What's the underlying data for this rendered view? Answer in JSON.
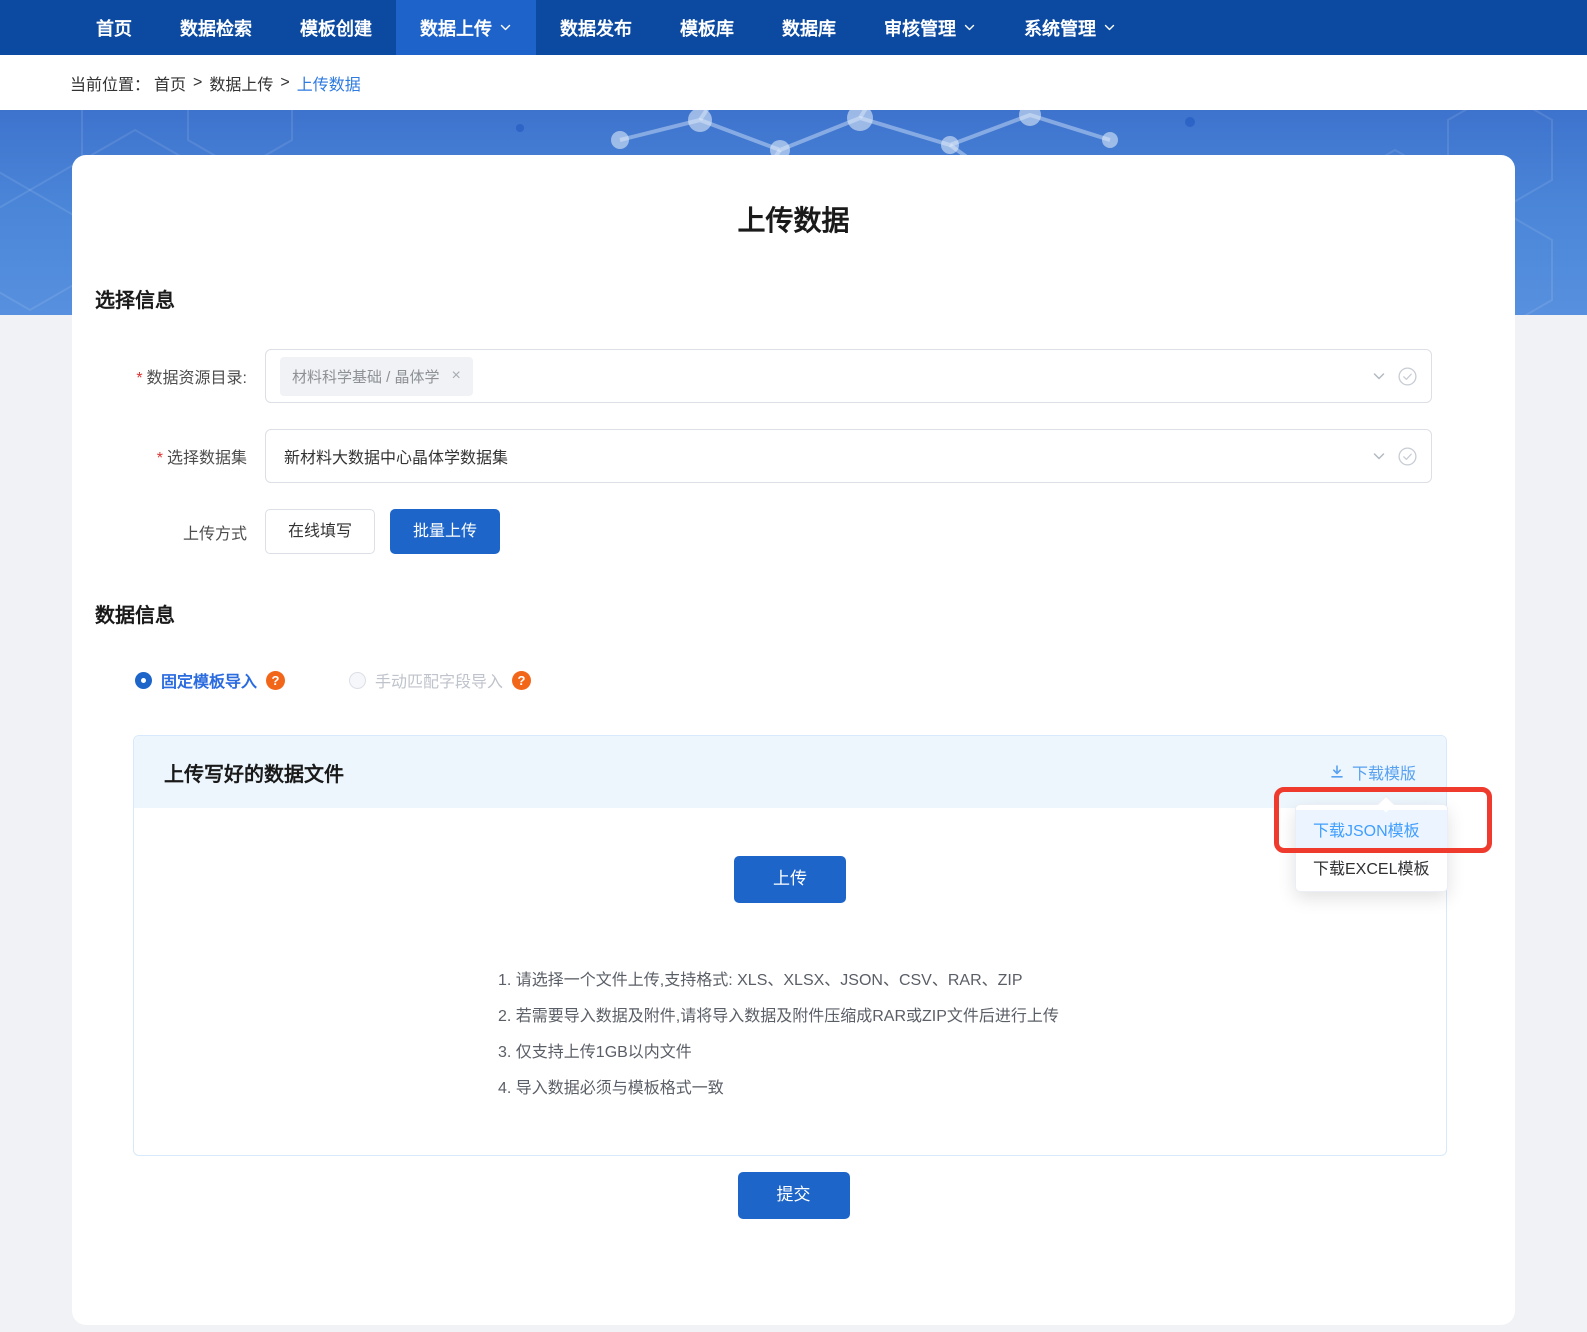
{
  "nav": {
    "items": [
      {
        "label": "首页",
        "active": false,
        "has_dropdown": false
      },
      {
        "label": "数据检索",
        "active": false,
        "has_dropdown": false
      },
      {
        "label": "模板创建",
        "active": false,
        "has_dropdown": false
      },
      {
        "label": "数据上传",
        "active": true,
        "has_dropdown": true
      },
      {
        "label": "数据发布",
        "active": false,
        "has_dropdown": false
      },
      {
        "label": "模板库",
        "active": false,
        "has_dropdown": false
      },
      {
        "label": "数据库",
        "active": false,
        "has_dropdown": false
      },
      {
        "label": "审核管理",
        "active": false,
        "has_dropdown": true
      },
      {
        "label": "系统管理",
        "active": false,
        "has_dropdown": true
      }
    ]
  },
  "breadcrumb": {
    "prefix": "当前位置：",
    "separator": ">",
    "items": [
      "首页",
      "数据上传",
      "上传数据"
    ]
  },
  "page": {
    "title": "上传数据"
  },
  "sections": {
    "select_info": "选择信息",
    "data_info": "数据信息"
  },
  "form": {
    "catalog": {
      "label": "数据资源目录:",
      "required": "*",
      "tag": "材料科学基础 / 晶体学",
      "tag_close": "×"
    },
    "dataset": {
      "label": "选择数据集",
      "required": "*",
      "value": "新材料大数据中心晶体学数据集"
    },
    "upload_method": {
      "label": "上传方式",
      "options": [
        {
          "label": "在线填写",
          "active": false
        },
        {
          "label": "批量上传",
          "active": true
        }
      ]
    }
  },
  "import_modes": {
    "fixed": {
      "label": "固定模板导入",
      "selected": true,
      "help": "?"
    },
    "manual": {
      "label": "手动匹配字段导入",
      "selected": false,
      "help": "?"
    }
  },
  "upload_panel": {
    "title": "上传写好的数据文件",
    "download_link": "下载模版",
    "upload_button": "上传",
    "instructions": [
      "1. 请选择一个文件上传,支持格式: XLS、XLSX、JSON、CSV、RAR、ZIP",
      "2. 若需要导入数据及附件,请将导入数据及附件压缩成RAR或ZIP文件后进行上传",
      "3. 仅支持上传1GB以内文件",
      "4. 导入数据必须与模板格式一致"
    ],
    "submit_button": "提交"
  },
  "download_menu": {
    "items": [
      {
        "label": "下载JSON模板",
        "highlighted": true
      },
      {
        "label": "下载EXCEL模板",
        "highlighted": false
      }
    ]
  },
  "colors": {
    "nav_bg": "#0c4aa1",
    "nav_active_bg": "#1e63c9",
    "primary_blue": "#1d65c9",
    "link_blue": "#2d7ae0",
    "light_link_blue": "#58a1f0",
    "menu_highlight_blue": "#409eff",
    "help_orange": "#f2661a",
    "annotation_red": "#ee3b2d",
    "hero_blue": "#4a85d8",
    "panel_header_bg": "#edf6fd"
  }
}
